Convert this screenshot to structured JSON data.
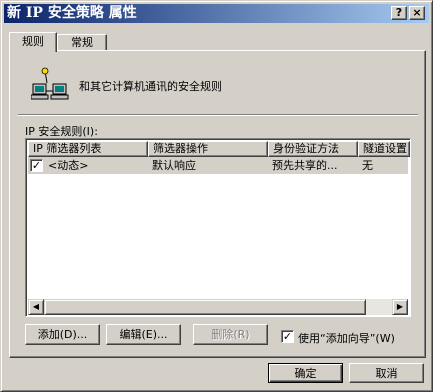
{
  "window": {
    "title": "新 IP 安全策略 属性",
    "help_button": "?",
    "close_button": "×"
  },
  "tabs": [
    {
      "label": "规则",
      "active": true
    },
    {
      "label": "常规",
      "active": false
    }
  ],
  "rules_page": {
    "description": "和其它计算机通讯的安全规则",
    "list_label": "IP 安全规则(I):",
    "columns": [
      "IP 筛选器列表",
      "筛选器操作",
      "身份验证方法",
      "隧道设置"
    ],
    "rows": [
      {
        "checked": true,
        "cells": [
          "<动态>",
          "默认响应",
          "预先共享的...",
          "无"
        ]
      }
    ],
    "add_button": "添加(D)...",
    "edit_button": "编辑(E)...",
    "remove_button": "删除(R)",
    "wizard_checkbox": {
      "checked": true,
      "label": "使用“添加向导”(W)"
    }
  },
  "footer": {
    "ok_button": "确定",
    "cancel_button": "取消"
  },
  "colors": {
    "face": "#d4d0c8",
    "title_start": "#0a246a",
    "title_end": "#a6caf0"
  }
}
